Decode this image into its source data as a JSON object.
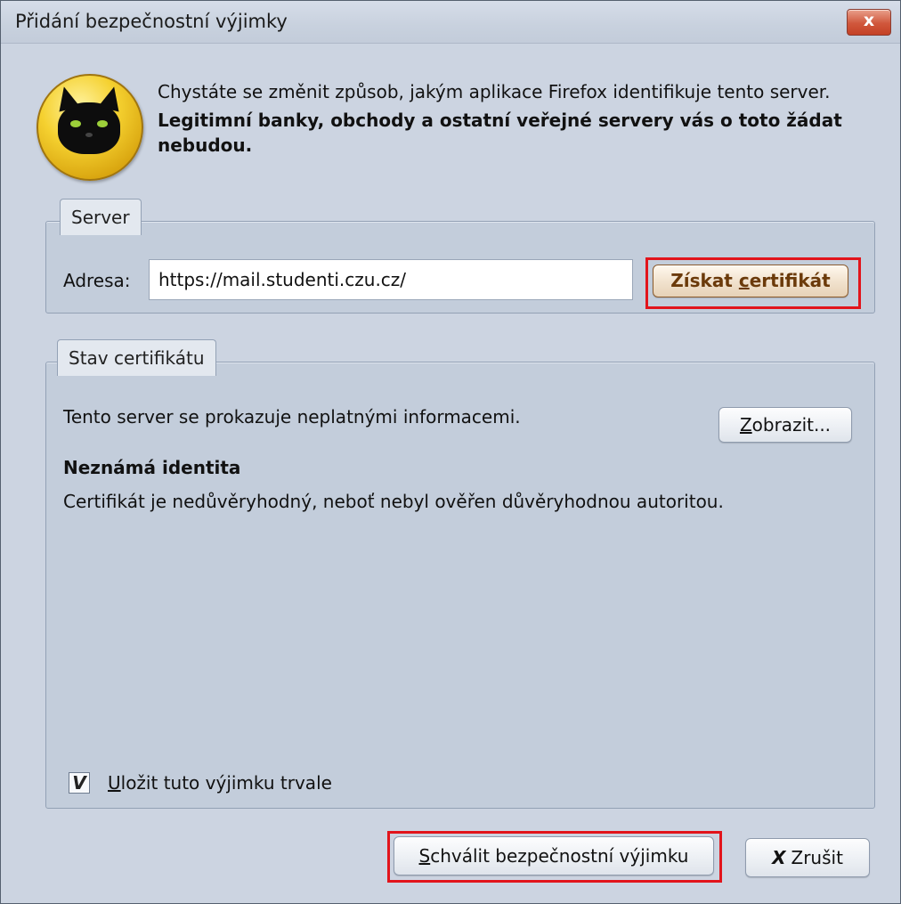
{
  "window": {
    "title": "Přidání bezpečnostní výjimky",
    "close_label": "x"
  },
  "intro": {
    "line": "Chystáte se změnit způsob, jakým aplikace Firefox identifikuje tento server.",
    "warning": "Legitimní banky, obchody a ostatní veřejné servery vás o toto žádat nebudou."
  },
  "server": {
    "tab_label": "Server",
    "address_label": "Adresa:",
    "address_value": "https://mail.studenti.czu.cz/",
    "get_cert_prefix": "Získat ",
    "get_cert_accel": "c",
    "get_cert_suffix": "ertifikát"
  },
  "cert_status": {
    "tab_label": "Stav certifikátu",
    "message": "Tento server se prokazuje neplatnými informacemi.",
    "view_accel": "Z",
    "view_rest": "obrazit...",
    "heading": "Neznámá identita",
    "description": "Certifikát je nedůvěryhodný, neboť nebyl ověřen důvěryhodnou autoritou."
  },
  "permanent": {
    "checked": true,
    "check_glyph": "V",
    "label_accel": "U",
    "label_rest": "ložit tuto výjimku trvale"
  },
  "footer": {
    "approve_accel": "S",
    "approve_rest": "chválit bezpečnostní výjimku",
    "cancel_glyph": "X",
    "cancel_label": "Zrušit"
  },
  "colors": {
    "highlight": "#e2141b",
    "cert_button_text": "#6b3a0a"
  }
}
